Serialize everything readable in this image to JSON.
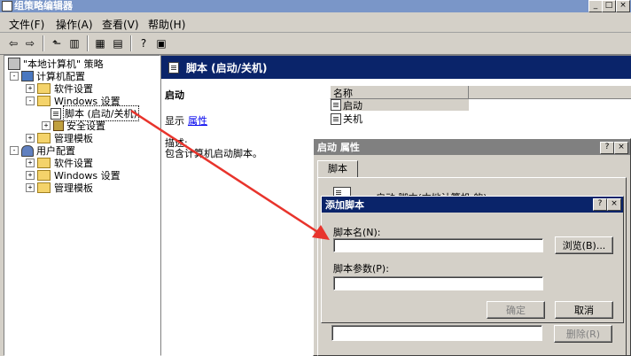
{
  "window": {
    "title": "组策略编辑器",
    "min": "_",
    "max": "□",
    "close": "×"
  },
  "menu": [
    "文件(F)",
    "操作(A)",
    "查看(V)",
    "帮助(H)"
  ],
  "tree": {
    "root": "\"本地计算机\" 策略",
    "computer": "计算机配置",
    "software1": "软件设置",
    "windows1": "Windows 设置",
    "scripts": "脚本 (启动/关机)",
    "security": "安全设置",
    "admin1": "管理模板",
    "user": "用户配置",
    "software2": "软件设置",
    "windows2": "Windows 设置",
    "admin2": "管理模板"
  },
  "right": {
    "header": "脚本 (启动/关机)",
    "section": "启动",
    "show": "显示",
    "props_link": "属性",
    "desc_label": "描述:",
    "desc_text": "包含计算机启动脚本。",
    "column_name": "名称",
    "items": [
      "启动",
      "关机"
    ]
  },
  "props_dialog": {
    "title": "启动 属性",
    "help": "?",
    "close": "×",
    "tab": "脚本",
    "partial_text": "启动 脚本(本地计算机 的)",
    "delete_btn": "删除(R)"
  },
  "add_dialog": {
    "title": "添加脚本",
    "help": "?",
    "close": "×",
    "name_label": "脚本名(N):",
    "name_value": "",
    "browse": "浏览(B)...",
    "params_label": "脚本参数(P):",
    "params_value": "",
    "ok": "确定",
    "cancel": "取消"
  },
  "colors": {
    "titlebar": "#7a96c8",
    "active_title": "#0a246a",
    "arrow": "#e8342c"
  }
}
